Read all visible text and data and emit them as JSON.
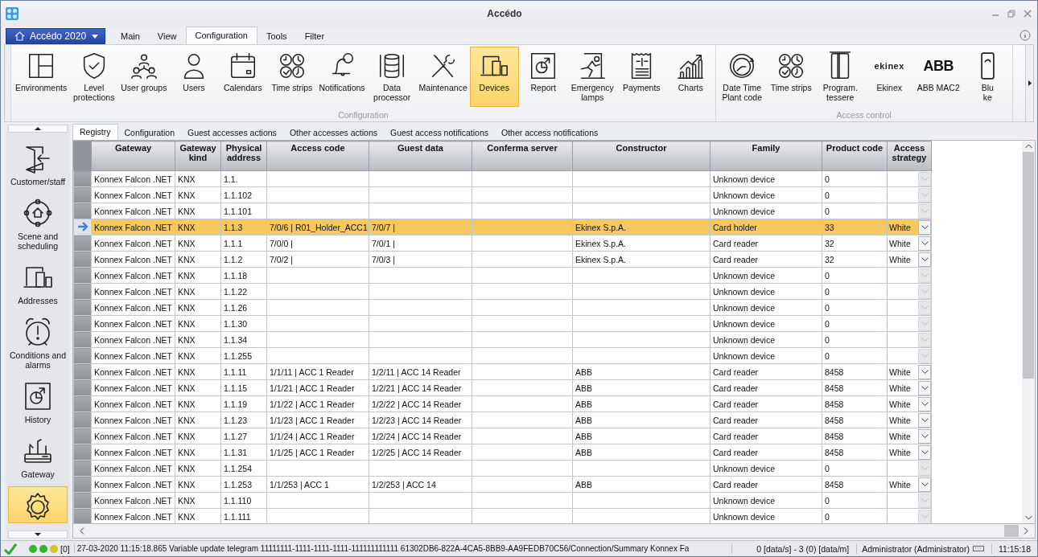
{
  "window": {
    "title": "Accédo"
  },
  "app_menu": {
    "label": "Accédo 2020"
  },
  "menu_tabs": [
    {
      "label": "Main",
      "selected": false
    },
    {
      "label": "View",
      "selected": false
    },
    {
      "label": "Configuration",
      "selected": true
    },
    {
      "label": "Tools",
      "selected": false
    },
    {
      "label": "Filter",
      "selected": false
    }
  ],
  "ribbon": {
    "groups": [
      {
        "title": "Configuration",
        "items": [
          {
            "label": "Environments",
            "kind": "icon",
            "selected": false
          },
          {
            "label": "Level\nprotections",
            "kind": "icon",
            "selected": false
          },
          {
            "label": "User groups",
            "kind": "icon",
            "selected": false
          },
          {
            "label": "Users",
            "kind": "icon",
            "selected": false
          },
          {
            "label": "Calendars",
            "kind": "icon",
            "selected": false
          },
          {
            "label": "Time strips",
            "kind": "icon",
            "selected": false
          },
          {
            "label": "Notifications",
            "kind": "icon",
            "selected": false
          },
          {
            "label": "Data\nprocessor",
            "kind": "icon",
            "selected": false
          },
          {
            "label": "Maintenance",
            "kind": "icon",
            "selected": false
          },
          {
            "label": "Devices",
            "kind": "icon",
            "selected": true
          },
          {
            "label": "Report",
            "kind": "icon",
            "selected": false
          },
          {
            "label": "Emergency\nlamps",
            "kind": "icon",
            "selected": false
          },
          {
            "label": "Payments",
            "kind": "icon",
            "selected": false
          },
          {
            "label": "Charts",
            "kind": "icon",
            "selected": false
          }
        ]
      },
      {
        "title": "Access control",
        "items": [
          {
            "label": "Date Time\nPlant code",
            "kind": "icon",
            "selected": false
          },
          {
            "label": "Time strips",
            "kind": "icon",
            "selected": false
          },
          {
            "label": "Program.\ntessere",
            "kind": "icon",
            "selected": false
          },
          {
            "label": "Ekinex",
            "kind": "logo",
            "logo_text": "ekinex",
            "selected": false
          },
          {
            "label": "ABB MAC2",
            "kind": "logo",
            "logo_text": "ABB",
            "selected": false
          },
          {
            "label": "Blu\nke",
            "kind": "icon",
            "selected": false
          }
        ]
      }
    ]
  },
  "sidebar": {
    "items": [
      {
        "label": "Customer/staff",
        "selected": false
      },
      {
        "label": "Scene and scheduling",
        "selected": false
      },
      {
        "label": "Addresses",
        "selected": false
      },
      {
        "label": "Conditions and alarms",
        "selected": false
      },
      {
        "label": "History",
        "selected": false
      },
      {
        "label": "Gateway",
        "selected": false
      },
      {
        "selected": true
      }
    ]
  },
  "grid_tabs": [
    {
      "label": "Registry",
      "selected": true
    },
    {
      "label": "Configuration",
      "selected": false
    },
    {
      "label": "Guest accesses actions",
      "selected": false
    },
    {
      "label": "Other accesses actions",
      "selected": false
    },
    {
      "label": "Guest access notifications",
      "selected": false
    },
    {
      "label": "Other access notifications",
      "selected": false
    }
  ],
  "table": {
    "columns": [
      "Gateway",
      "Gateway kind",
      "Physical address",
      "Access code",
      "Guest data",
      "Conferma server",
      "Constructor",
      "Family",
      "Product code",
      "Access strategy"
    ],
    "rows": [
      {
        "selected": false,
        "cells": [
          "Konnex Falcon .NET",
          "KNX",
          "1.1.",
          null,
          null,
          null,
          null,
          "Unknown device",
          "0",
          null
        ]
      },
      {
        "selected": false,
        "cells": [
          "Konnex Falcon .NET",
          "KNX",
          "1.1.102",
          null,
          null,
          null,
          null,
          "Unknown device",
          "0",
          null
        ]
      },
      {
        "selected": false,
        "cells": [
          "Konnex Falcon .NET",
          "KNX",
          "1.1.101",
          null,
          null,
          null,
          null,
          "Unknown device",
          "0",
          null
        ]
      },
      {
        "selected": true,
        "cells": [
          "Konnex Falcon .NET",
          "KNX",
          "1.1.3",
          "7/0/6 | R01_Holder_ACC1",
          "7/0/7 |",
          null,
          "Ekinex S.p.A.",
          "Card holder",
          "33",
          "White"
        ]
      },
      {
        "selected": false,
        "cells": [
          "Konnex Falcon .NET",
          "KNX",
          "1.1.1",
          "7/0/0 |",
          "7/0/1 |",
          null,
          "Ekinex S.p.A.",
          "Card reader",
          "32",
          "White"
        ]
      },
      {
        "selected": false,
        "cells": [
          "Konnex Falcon .NET",
          "KNX",
          "1.1.2",
          "7/0/2 |",
          "7/0/3 |",
          null,
          "Ekinex S.p.A.",
          "Card reader",
          "32",
          "White"
        ]
      },
      {
        "selected": false,
        "cells": [
          "Konnex Falcon .NET",
          "KNX",
          "1.1.18",
          null,
          null,
          null,
          null,
          "Unknown device",
          "0",
          null
        ]
      },
      {
        "selected": false,
        "cells": [
          "Konnex Falcon .NET",
          "KNX",
          "1.1.22",
          null,
          null,
          null,
          null,
          "Unknown device",
          "0",
          null
        ]
      },
      {
        "selected": false,
        "cells": [
          "Konnex Falcon .NET",
          "KNX",
          "1.1.26",
          null,
          null,
          null,
          null,
          "Unknown device",
          "0",
          null
        ]
      },
      {
        "selected": false,
        "cells": [
          "Konnex Falcon .NET",
          "KNX",
          "1.1.30",
          null,
          null,
          null,
          null,
          "Unknown device",
          "0",
          null
        ]
      },
      {
        "selected": false,
        "cells": [
          "Konnex Falcon .NET",
          "KNX",
          "1.1.34",
          null,
          null,
          null,
          null,
          "Unknown device",
          "0",
          null
        ]
      },
      {
        "selected": false,
        "cells": [
          "Konnex Falcon .NET",
          "KNX",
          "1.1.255",
          null,
          null,
          null,
          null,
          "Unknown device",
          "0",
          null
        ]
      },
      {
        "selected": false,
        "cells": [
          "Konnex Falcon .NET",
          "KNX",
          "1.1.11",
          "1/1/11 | ACC 1 Reader",
          "1/2/11 | ACC 14 Reader",
          null,
          "ABB",
          "Card reader",
          "8458",
          "White"
        ]
      },
      {
        "selected": false,
        "cells": [
          "Konnex Falcon .NET",
          "KNX",
          "1.1.15",
          "1/1/21 | ACC 1 Reader",
          "1/2/21 | ACC 14 Reader",
          null,
          "ABB",
          "Card reader",
          "8458",
          "White"
        ]
      },
      {
        "selected": false,
        "cells": [
          "Konnex Falcon .NET",
          "KNX",
          "1.1.19",
          "1/1/22 | ACC 1 Reader",
          "1/2/22 | ACC 14 Reader",
          null,
          "ABB",
          "Card reader",
          "8458",
          "White"
        ]
      },
      {
        "selected": false,
        "cells": [
          "Konnex Falcon .NET",
          "KNX",
          "1.1.23",
          "1/1/23 | ACC 1 Reader",
          "1/2/23 | ACC 14 Reader",
          null,
          "ABB",
          "Card reader",
          "8458",
          "White"
        ]
      },
      {
        "selected": false,
        "cells": [
          "Konnex Falcon .NET",
          "KNX",
          "1.1.27",
          "1/1/24 | ACC 1 Reader",
          "1/2/24 | ACC 14 Reader",
          null,
          "ABB",
          "Card reader",
          "8458",
          "White"
        ]
      },
      {
        "selected": false,
        "cells": [
          "Konnex Falcon .NET",
          "KNX",
          "1.1.31",
          "1/1/25 | ACC 1 Reader",
          "1/2/25 | ACC 14 Reader",
          null,
          "ABB",
          "Card reader",
          "8458",
          "White"
        ]
      },
      {
        "selected": false,
        "cells": [
          "Konnex Falcon .NET",
          "KNX",
          "1.1.254",
          null,
          null,
          null,
          null,
          "Unknown device",
          "0",
          null
        ]
      },
      {
        "selected": false,
        "cells": [
          "Konnex Falcon .NET",
          "KNX",
          "1.1.253",
          "1/1/253 | ACC 1",
          "1/2/253 | ACC 14",
          null,
          "ABB",
          "Card reader",
          "8458",
          "White"
        ]
      },
      {
        "selected": false,
        "cells": [
          "Konnex Falcon .NET",
          "KNX",
          "1.1.110",
          null,
          null,
          null,
          null,
          "Unknown device",
          "0",
          null
        ]
      },
      {
        "selected": false,
        "cells": [
          "Konnex Falcon .NET",
          "KNX",
          "1.1.111",
          null,
          null,
          null,
          null,
          "Unknown device",
          "0",
          null
        ]
      }
    ]
  },
  "status_bar": {
    "lights": [
      {
        "color": "#2fb82f"
      },
      {
        "color": "#2fb82f"
      },
      {
        "color": "#d4c42a"
      }
    ],
    "queue": "[0]",
    "message": "27-03-2020 11:15:18.865 Variable update telegram 11111111-1111-1111-1111-111111111111 61302DB6-822A-4CA5-8BB9-AA9FEDB70C56/Connection/Summary Konnex Fa",
    "rate": "0 [data/s] - 3 (0) [data/m]",
    "user": "Administrator (Administrator)",
    "time": "11:15:18"
  }
}
